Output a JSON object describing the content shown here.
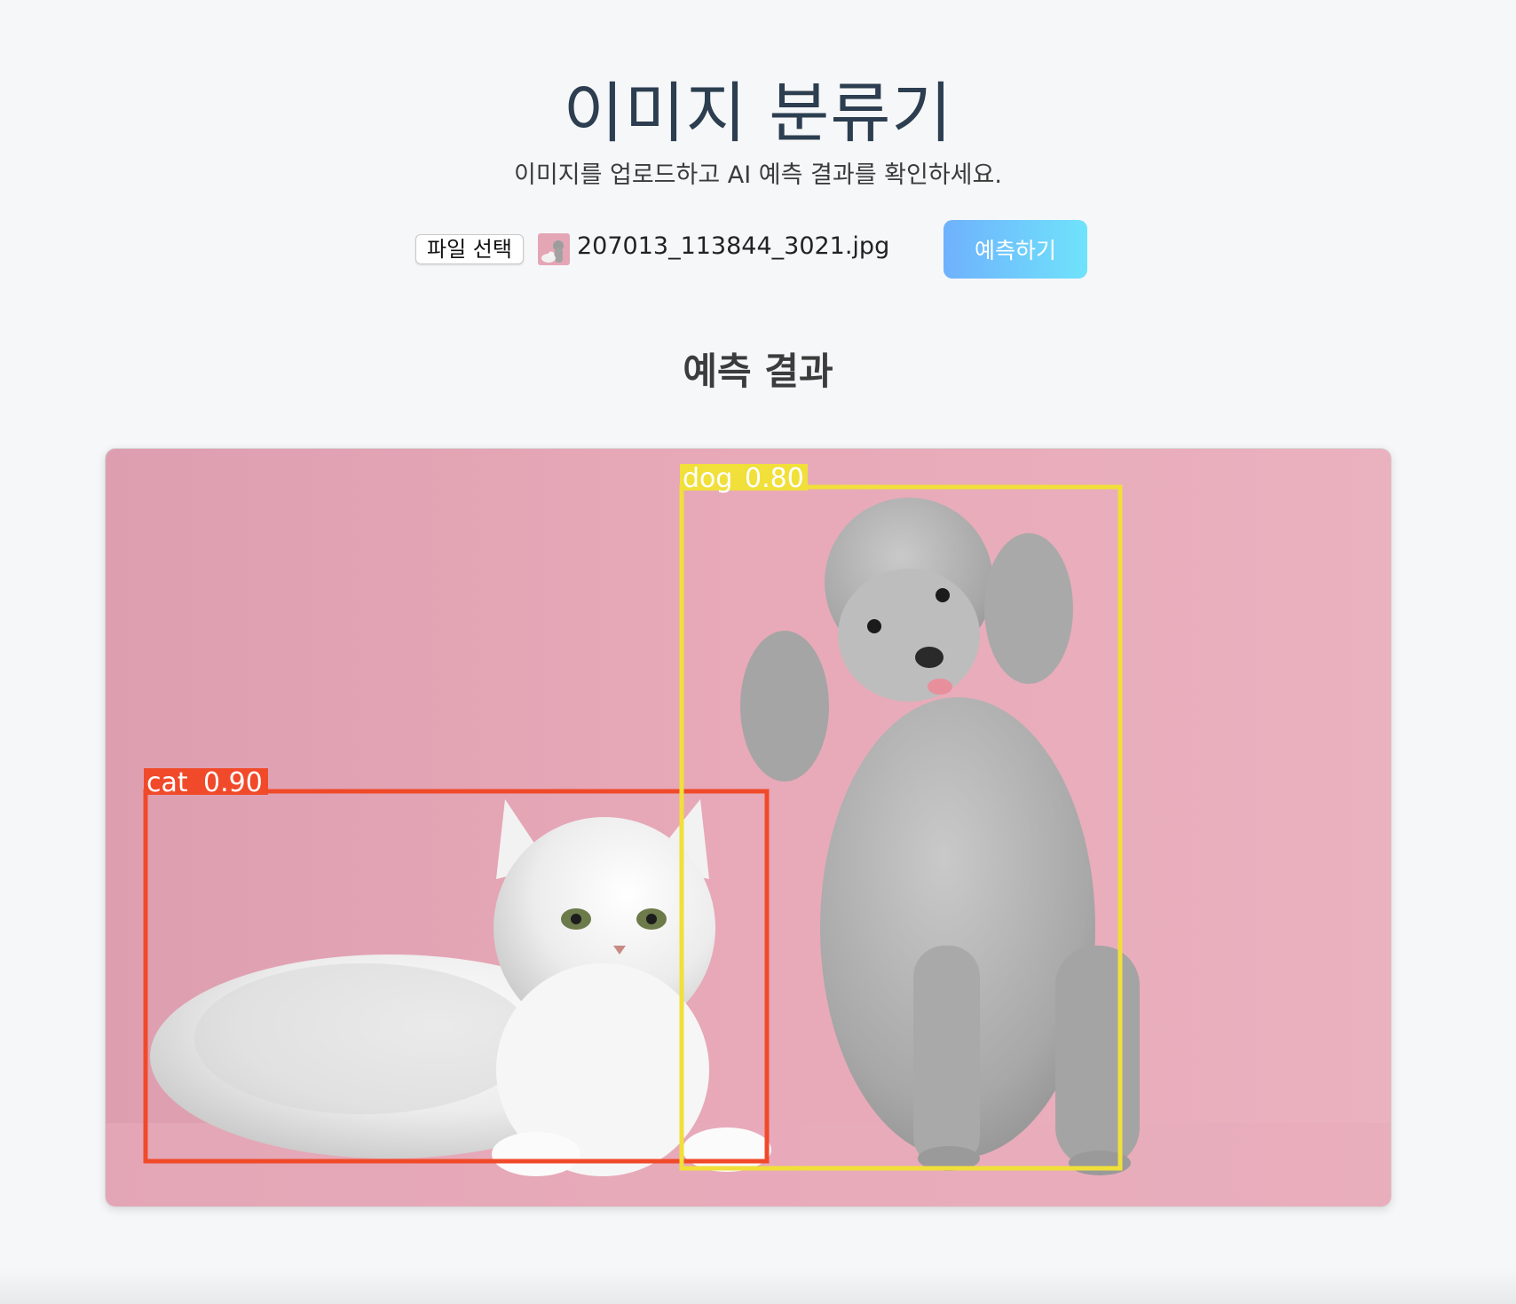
{
  "header": {
    "title": "이미지 분류기",
    "subtitle": "이미지를 업로드하고 AI 예측 결과를 확인하세요."
  },
  "upload": {
    "file_button_label": "파일 선택",
    "file_name": "207013_113844_3021.jpg",
    "predict_button_label": "예측하기"
  },
  "result": {
    "section_title": "예측 결과",
    "detections": [
      {
        "label": "cat",
        "score": "0.90",
        "color": "#f04a2a"
      },
      {
        "label": "dog",
        "score": "0.80",
        "color": "#f1df3a"
      }
    ]
  },
  "colors": {
    "page_bg": "#f6f7f9",
    "title": "#2c3e50",
    "photo_bg": "#e8aab8",
    "button_gradient_start": "#6fb1fc",
    "button_gradient_end": "#6fe3fb"
  }
}
